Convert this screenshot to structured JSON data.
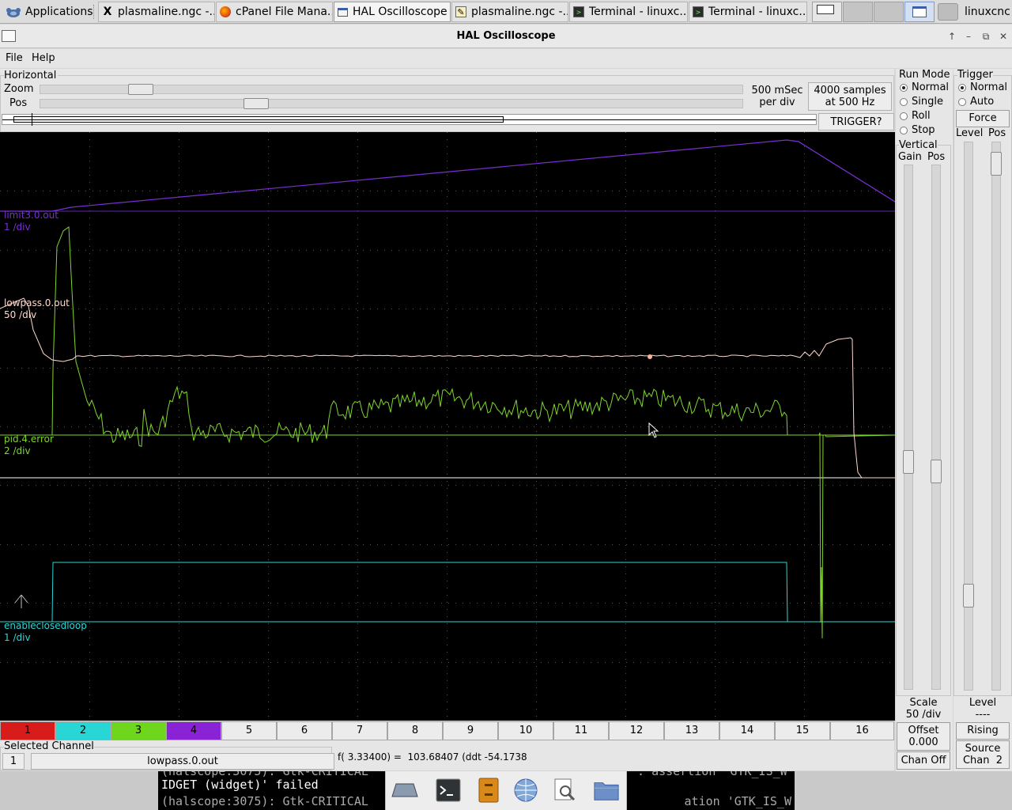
{
  "taskbar": {
    "apps_label": "Applications",
    "tasks": [
      {
        "label": "plasmaline.ngc -...",
        "icon": "x-editor-icon"
      },
      {
        "label": "cPanel File Mana...",
        "icon": "firefox-icon"
      },
      {
        "label": "HAL Oscilloscope",
        "icon": "window-icon"
      },
      {
        "label": "plasmaline.ngc -...",
        "icon": "text-editor-icon"
      },
      {
        "label": "Terminal - linuxc...",
        "icon": "terminal-icon"
      },
      {
        "label": "Terminal - linuxc...",
        "icon": "terminal-icon"
      }
    ],
    "user": "linuxcnc"
  },
  "window": {
    "title": "HAL Oscilloscope"
  },
  "menu": {
    "file": "File",
    "help": "Help"
  },
  "horizontal": {
    "title": "Horizontal",
    "zoom_label": "Zoom",
    "pos_label": "Pos",
    "zoom_value": 0.13,
    "pos_value": 0.3,
    "timebase_line1": "500 mSec",
    "timebase_line2": "per div",
    "samples_line1": "4000 samples",
    "samples_line2": "at 500 Hz",
    "trigger_status": "TRIGGER?"
  },
  "run_mode": {
    "title": "Run Mode",
    "options": [
      "Normal",
      "Single",
      "Roll",
      "Stop"
    ],
    "selected": "Normal"
  },
  "trigger": {
    "title": "Trigger",
    "options": [
      "Normal",
      "Auto"
    ],
    "selected": "Normal",
    "force_label": "Force",
    "level_label": "Level",
    "pos_label": "Pos",
    "bottom_level_label": "Level",
    "bottom_level_value": "----",
    "edge_label": "Rising",
    "source_line1": "Source",
    "source_line2": "Chan  2"
  },
  "vertical": {
    "title": "Vertical",
    "gain_label": "Gain",
    "pos_label": "Pos",
    "scale_label": "Scale",
    "scale_value": "50 /div",
    "offset_label": "Offset",
    "offset_value": "0.000",
    "chan_off_label": "Chan Off"
  },
  "traces": [
    {
      "name": "limit3.0.out",
      "scale": "1 /div",
      "color": "#7a2fd6"
    },
    {
      "name": "lowpass.0.out",
      "scale": "50 /div",
      "color": "#ffd9cc"
    },
    {
      "name": "pid.4.error",
      "scale": "2 /div",
      "color": "#7fd62c"
    },
    {
      "name": "enableclosedloop",
      "scale": "1 /div",
      "color": "#2cd6d6"
    }
  ],
  "channels": [
    {
      "label": "1",
      "color": "#d81b1b"
    },
    {
      "label": "2",
      "color": "#28d6d6"
    },
    {
      "label": "3",
      "color": "#6fd61e"
    },
    {
      "label": "4",
      "color": "#8a22d6"
    },
    {
      "label": "5",
      "color": ""
    },
    {
      "label": "6",
      "color": ""
    },
    {
      "label": "7",
      "color": ""
    },
    {
      "label": "8",
      "color": ""
    },
    {
      "label": "9",
      "color": ""
    },
    {
      "label": "10",
      "color": ""
    },
    {
      "label": "11",
      "color": ""
    },
    {
      "label": "12",
      "color": ""
    },
    {
      "label": "13",
      "color": ""
    },
    {
      "label": "14",
      "color": ""
    },
    {
      "label": "15",
      "color": ""
    },
    {
      "label": "16",
      "color": ""
    }
  ],
  "selected_channel": {
    "title": "Selected Channel",
    "number": "1",
    "name": "lowpass.0.out",
    "readout": "f( 3.33400) =  103.68407 (ddt -54.1738"
  },
  "desktop": {
    "terminal_line1": "(halscope:3075): Gtk-CRITICAL",
    "terminal_line2": "IDGET (widget)' failed",
    "terminal_line3": "(halscope:3075): Gtk-CRITICAL",
    "terminal_right_line1": "': assertion 'GTK_IS_W",
    "terminal_right_line3": "ation 'GTK_IS_W"
  }
}
